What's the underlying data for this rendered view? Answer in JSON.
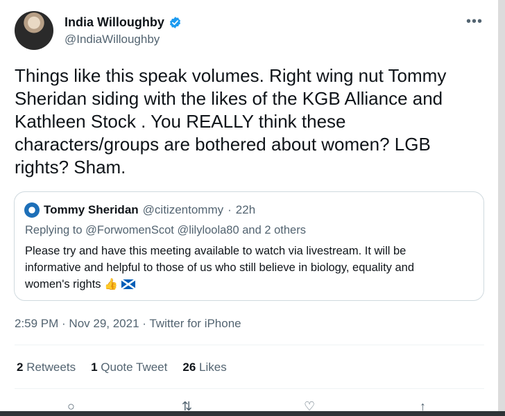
{
  "author": {
    "display_name": "India Willoughby",
    "handle": "@IndiaWilloughby",
    "verified": true
  },
  "tweet": {
    "text": "Things like this speak volumes. Right wing nut Tommy\nSheridan siding with the likes of the KGB Alliance and\nKathleen Stock . You REALLY think these\ncharacters/groups are bothered about women? LGB\nrights? Sham.",
    "timestamp": "2:59 PM · Nov 29, 2021 · Twitter for iPhone"
  },
  "quoted": {
    "name": "Tommy Sheridan",
    "handle": "@citizentommy",
    "sep": "·",
    "time": "22h",
    "replying_prefix": "Replying to",
    "replying_to": "@ForwomenScot @lilyloola80 and 2 others",
    "text_line1": "Please try and have this meeting available to watch via livestream. It will be",
    "text_line2": "informative and helpful to those of us who still believe in biology, equality and",
    "text_line3": "women's rights",
    "emoji": "👍"
  },
  "stats": {
    "retweets_count": "2",
    "retweets_label": "Retweets",
    "quotes_count": "1",
    "quotes_label": "Quote Tweet",
    "likes_count": "26",
    "likes_label": "Likes"
  },
  "actions": {
    "reply": "○",
    "retweet": "⇅",
    "like": "♡",
    "share": "↑"
  },
  "colors": {
    "accent": "#1d9bf0",
    "secondary_text": "#536471",
    "border": "#cfd9de"
  }
}
